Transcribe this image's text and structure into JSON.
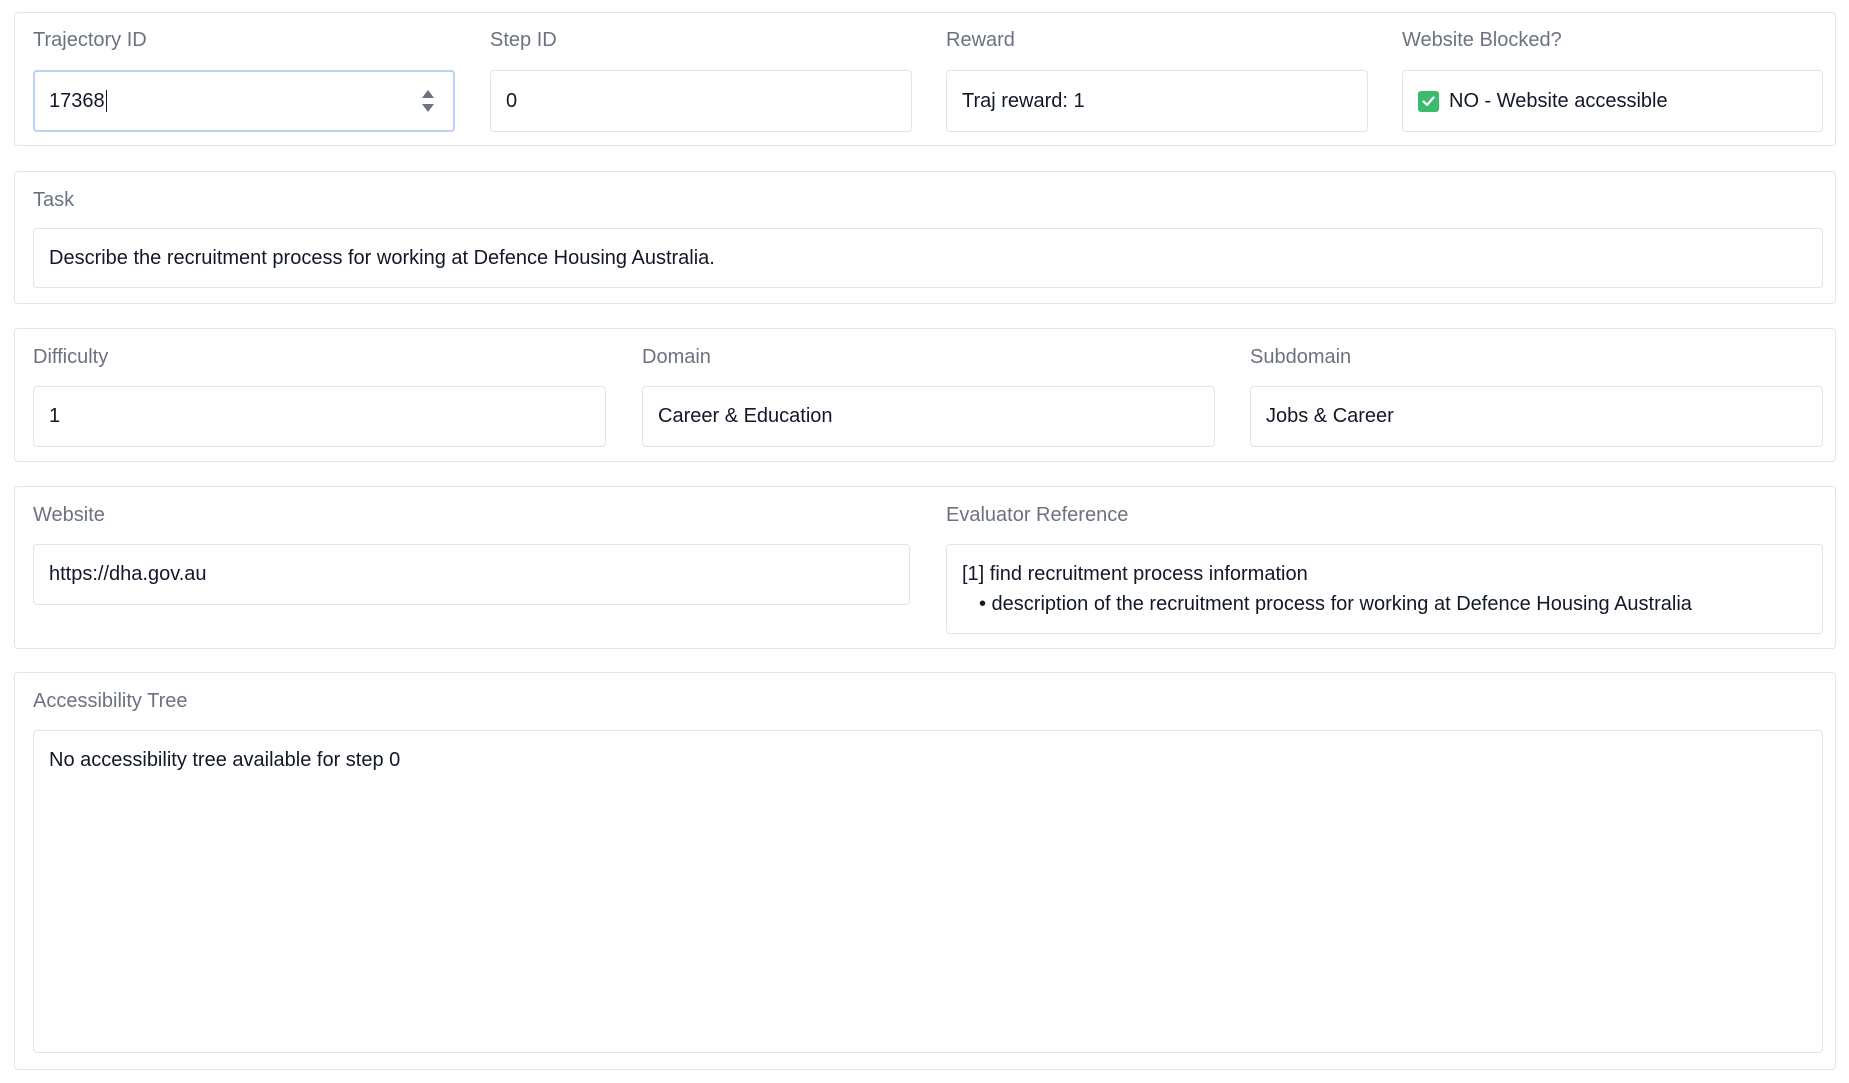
{
  "trajectory_id": {
    "label": "Trajectory ID",
    "value": "17368"
  },
  "step_id": {
    "label": "Step ID",
    "value": "0"
  },
  "reward": {
    "label": "Reward",
    "value": "Traj reward: 1"
  },
  "website_blocked": {
    "label": "Website Blocked?",
    "value": "NO - Website accessible",
    "icon": "check-icon",
    "icon_color": "#3dbb6c"
  },
  "task": {
    "label": "Task",
    "value": "Describe the recruitment process for working at Defence Housing Australia."
  },
  "difficulty": {
    "label": "Difficulty",
    "value": "1"
  },
  "domain": {
    "label": "Domain",
    "value": "Career & Education"
  },
  "subdomain": {
    "label": "Subdomain",
    "value": "Jobs & Career"
  },
  "website": {
    "label": "Website",
    "value": "https://dha.gov.au"
  },
  "evaluator_reference": {
    "label": "Evaluator Reference",
    "line1": "[1] find recruitment process information",
    "bullet": "• description of the recruitment process for working at Defence Housing Australia"
  },
  "accessibility_tree": {
    "label": "Accessibility Tree",
    "value": "No accessibility tree available for step 0"
  },
  "colors": {
    "focus_border": "#bcd3f5",
    "border": "#e2e4e8",
    "label_text": "#6b7280"
  }
}
